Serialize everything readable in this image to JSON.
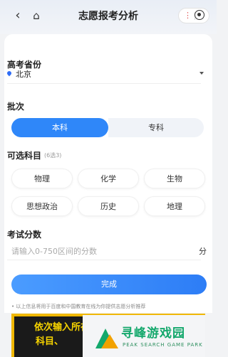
{
  "header": {
    "title": "志愿报考分析"
  },
  "form": {
    "province": {
      "label": "高考省份",
      "value": "北京"
    },
    "batch": {
      "label": "批次",
      "options": [
        "本科",
        "专科"
      ],
      "selected": "本科"
    },
    "subjects": {
      "label": "可选科目",
      "hint": "(6选3)",
      "options": [
        "物理",
        "化学",
        "生物",
        "思想政治",
        "历史",
        "地理"
      ]
    },
    "score": {
      "label": "考试分数",
      "placeholder": "请输入0-750区间的分数",
      "unit": "分"
    },
    "submit_label": "完成",
    "note": "• 以上信息将用于百度和中国教育在线为你提供志愿分析推荐"
  },
  "ad": {
    "line1": "依次输入所在省份、批次",
    "line2": "科目、"
  },
  "watermark": {
    "name": "寻峰游戏园",
    "sub": "PEAK SEARCH GAME PARK"
  },
  "colors": {
    "accent": "#2f87f9",
    "ad_bg": "#f0b800",
    "watermark": "#14a86c"
  }
}
